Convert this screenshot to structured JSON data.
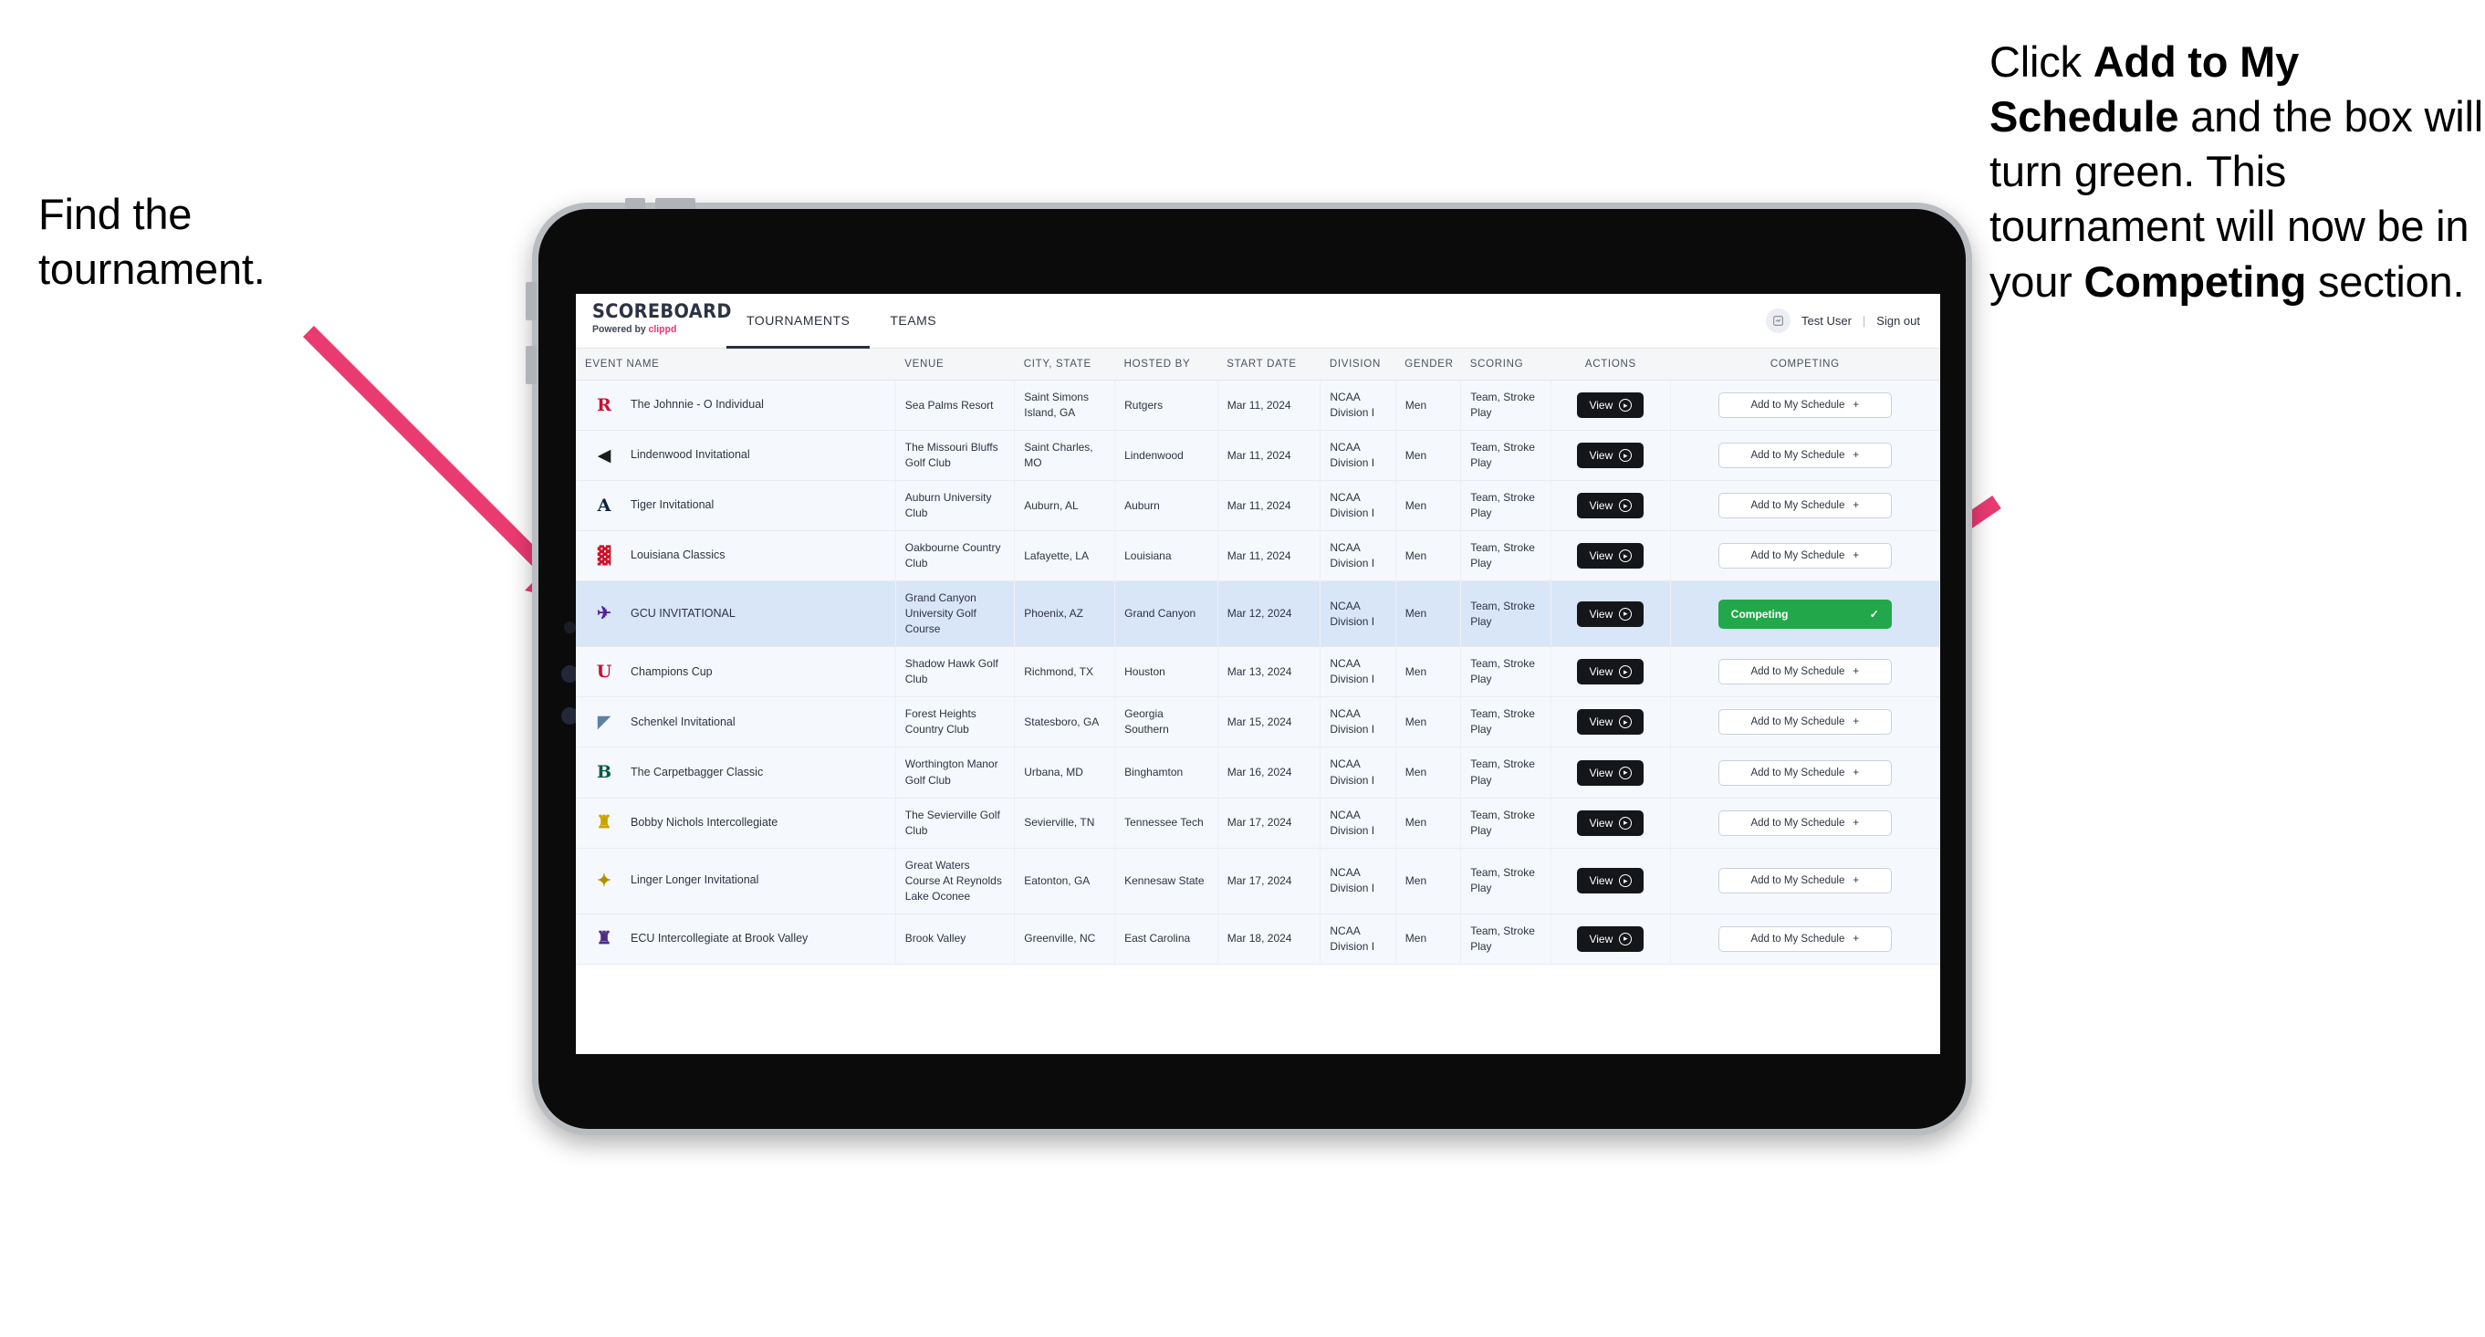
{
  "annotations": {
    "left": {
      "lines": [
        "Find the",
        "tournament."
      ]
    },
    "right": {
      "segments": [
        {
          "text": "Click ",
          "bold": false
        },
        {
          "text": "Add to My Schedule",
          "bold": true
        },
        {
          "text": " and the box will turn green. This tournament will now be in your ",
          "bold": false
        },
        {
          "text": "Competing",
          "bold": true
        },
        {
          "text": " section.",
          "bold": false
        }
      ]
    },
    "arrow_color": "#ea3a72"
  },
  "app": {
    "brand": {
      "title": "SCOREBOARD",
      "powered_prefix": "Powered by ",
      "powered_name": "clippd"
    },
    "nav": [
      {
        "label": "TOURNAMENTS",
        "active": true
      },
      {
        "label": "TEAMS",
        "active": false
      }
    ],
    "user": {
      "name": "Test User",
      "separator": "|",
      "signout": "Sign out",
      "avatar_icon": "user-avatar-icon"
    },
    "table": {
      "columns": [
        "EVENT NAME",
        "VENUE",
        "CITY, STATE",
        "HOSTED BY",
        "START DATE",
        "DIVISION",
        "GENDER",
        "SCORING",
        "ACTIONS",
        "COMPETING"
      ],
      "view_label": "View",
      "add_label": "Add to My Schedule",
      "add_plus": "+",
      "competing_label": "Competing",
      "competing_check": "✓",
      "rows": [
        {
          "logo": {
            "glyph": "R",
            "color": "#c8102e"
          },
          "event": "The Johnnie - O Individual",
          "venue": "Sea Palms Resort",
          "city": "Saint Simons Island, GA",
          "hosted_by": "Rutgers",
          "start_date": "Mar 11, 2024",
          "division": "NCAA Division I",
          "gender": "Men",
          "scoring": "Team, Stroke Play",
          "competing": false
        },
        {
          "logo": {
            "glyph": "◀",
            "color": "#1b1b1b"
          },
          "event": "Lindenwood Invitational",
          "venue": "The Missouri Bluffs Golf Club",
          "city": "Saint Charles, MO",
          "hosted_by": "Lindenwood",
          "start_date": "Mar 11, 2024",
          "division": "NCAA Division I",
          "gender": "Men",
          "scoring": "Team, Stroke Play",
          "competing": false
        },
        {
          "logo": {
            "glyph": "A",
            "color": "#0c2340"
          },
          "event": "Tiger Invitational",
          "venue": "Auburn University Club",
          "city": "Auburn, AL",
          "hosted_by": "Auburn",
          "start_date": "Mar 11, 2024",
          "division": "NCAA Division I",
          "gender": "Men",
          "scoring": "Team, Stroke Play",
          "competing": false
        },
        {
          "logo": {
            "glyph": "▓",
            "color": "#ce1126"
          },
          "event": "Louisiana Classics",
          "venue": "Oakbourne Country Club",
          "city": "Lafayette, LA",
          "hosted_by": "Louisiana",
          "start_date": "Mar 11, 2024",
          "division": "NCAA Division I",
          "gender": "Men",
          "scoring": "Team, Stroke Play",
          "competing": false
        },
        {
          "logo": {
            "glyph": "✈",
            "color": "#522398"
          },
          "event": "GCU INVITATIONAL",
          "venue": "Grand Canyon University Golf Course",
          "city": "Phoenix, AZ",
          "hosted_by": "Grand Canyon",
          "start_date": "Mar 12, 2024",
          "division": "NCAA Division I",
          "gender": "Men",
          "scoring": "Team, Stroke Play",
          "competing": true
        },
        {
          "logo": {
            "glyph": "U",
            "color": "#c8102e"
          },
          "event": "Champions Cup",
          "venue": "Shadow Hawk Golf Club",
          "city": "Richmond, TX",
          "hosted_by": "Houston",
          "start_date": "Mar 13, 2024",
          "division": "NCAA Division I",
          "gender": "Men",
          "scoring": "Team, Stroke Play",
          "competing": false
        },
        {
          "logo": {
            "glyph": "◤",
            "color": "#5e80a8"
          },
          "event": "Schenkel Invitational",
          "venue": "Forest Heights Country Club",
          "city": "Statesboro, GA",
          "hosted_by": "Georgia Southern",
          "start_date": "Mar 15, 2024",
          "division": "NCAA Division I",
          "gender": "Men",
          "scoring": "Team, Stroke Play",
          "competing": false
        },
        {
          "logo": {
            "glyph": "B",
            "color": "#005a43"
          },
          "event": "The Carpetbagger Classic",
          "venue": "Worthington Manor Golf Club",
          "city": "Urbana, MD",
          "hosted_by": "Binghamton",
          "start_date": "Mar 16, 2024",
          "division": "NCAA Division I",
          "gender": "Men",
          "scoring": "Team, Stroke Play",
          "competing": false
        },
        {
          "logo": {
            "glyph": "♜",
            "color": "#c8a300"
          },
          "event": "Bobby Nichols Intercollegiate",
          "venue": "The Sevierville Golf Club",
          "city": "Sevierville, TN",
          "hosted_by": "Tennessee Tech",
          "start_date": "Mar 17, 2024",
          "division": "NCAA Division I",
          "gender": "Men",
          "scoring": "Team, Stroke Play",
          "competing": false
        },
        {
          "logo": {
            "glyph": "✦",
            "color": "#b38f00"
          },
          "event": "Linger Longer Invitational",
          "venue": "Great Waters Course At Reynolds Lake Oconee",
          "city": "Eatonton, GA",
          "hosted_by": "Kennesaw State",
          "start_date": "Mar 17, 2024",
          "division": "NCAA Division I",
          "gender": "Men",
          "scoring": "Team, Stroke Play",
          "competing": false
        },
        {
          "logo": {
            "glyph": "♜",
            "color": "#4b2e83"
          },
          "event": "ECU Intercollegiate at Brook Valley",
          "venue": "Brook Valley",
          "city": "Greenville, NC",
          "hosted_by": "East Carolina",
          "start_date": "Mar 18, 2024",
          "division": "NCAA Division I",
          "gender": "Men",
          "scoring": "Team, Stroke Play",
          "competing": false
        }
      ]
    }
  }
}
